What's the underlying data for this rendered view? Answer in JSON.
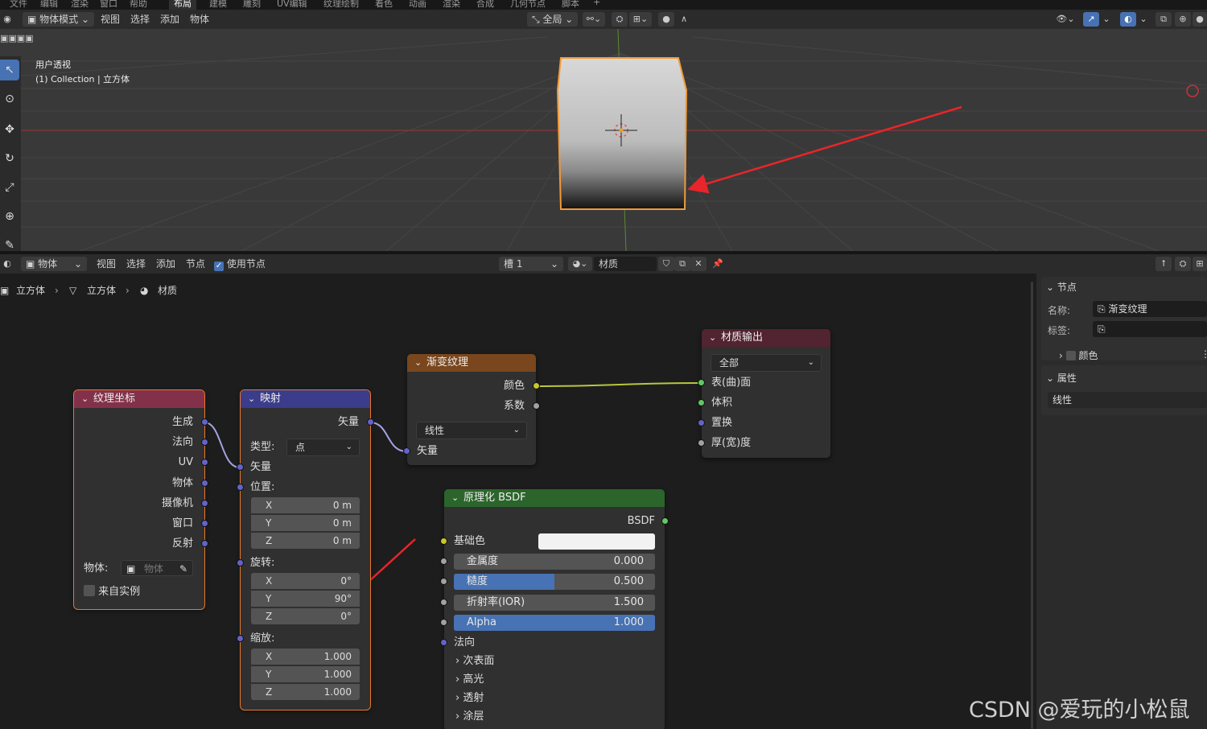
{
  "workspaces": [
    "文件",
    "编辑",
    "渲染",
    "窗口",
    "帮助",
    "布局",
    "建模",
    "雕刻",
    "UV编辑",
    "纹理绘制",
    "着色",
    "动画",
    "渲染",
    "合成",
    "几何节点",
    "脚本",
    "+"
  ],
  "viewport_header": {
    "mode": "物体模式",
    "menus": [
      "视图",
      "选择",
      "添加",
      "物体"
    ],
    "transform": "全局"
  },
  "viewport": {
    "view_name": "用户透视",
    "collection_info": "(1) Collection | 立方体"
  },
  "node_header": {
    "object_dropdown": "物体",
    "menus": [
      "视图",
      "选择",
      "添加",
      "节点"
    ],
    "use_nodes_label": "使用节点",
    "use_nodes": true,
    "slot": "槽 1",
    "material": "材质"
  },
  "breadcrumb": [
    "立方体",
    "立方体",
    "材质"
  ],
  "nodes": {
    "texcoord": {
      "title": "纹理坐标",
      "outputs": [
        "生成",
        "法向",
        "UV",
        "物体",
        "摄像机",
        "窗口",
        "反射"
      ],
      "object_label": "物体:",
      "object_placeholder": "物体",
      "from_instancer": "来自实例"
    },
    "mapping": {
      "title": "映射",
      "output": "矢量",
      "type_label": "类型:",
      "type_value": "点",
      "vector_label": "矢量",
      "location_label": "位置:",
      "location": [
        {
          "axis": "X",
          "value": "0 m"
        },
        {
          "axis": "Y",
          "value": "0 m"
        },
        {
          "axis": "Z",
          "value": "0 m"
        }
      ],
      "rotation_label": "旋转:",
      "rotation": [
        {
          "axis": "X",
          "value": "0°"
        },
        {
          "axis": "Y",
          "value": "90°"
        },
        {
          "axis": "Z",
          "value": "0°"
        }
      ],
      "scale_label": "缩放:",
      "scale": [
        {
          "axis": "X",
          "value": "1.000"
        },
        {
          "axis": "Y",
          "value": "1.000"
        },
        {
          "axis": "Z",
          "value": "1.000"
        }
      ]
    },
    "gradient": {
      "title": "渐变纹理",
      "out_color": "颜色",
      "out_fac": "系数",
      "type": "线性",
      "in_vector": "矢量"
    },
    "output": {
      "title": "材质输出",
      "target": "全部",
      "inputs": [
        "表(曲)面",
        "体积",
        "置换",
        "厚(宽)度"
      ]
    },
    "bsdf": {
      "title": "原理化 BSDF",
      "output": "BSDF",
      "base_color_label": "基础色",
      "sliders": [
        {
          "label": "金属度",
          "value": "0.000",
          "fill": 0.0
        },
        {
          "label": "糙度",
          "value": "0.500",
          "fill": 0.5
        },
        {
          "label": "折射率(IOR)",
          "value": "1.500",
          "fill": 0.0
        },
        {
          "label": "Alpha",
          "value": "1.000",
          "fill": 1.0
        }
      ],
      "normal_label": "法向",
      "panels": [
        "次表面",
        "高光",
        "透射",
        "涂层"
      ]
    }
  },
  "sidepanel": {
    "node_section": "节点",
    "name_label": "名称:",
    "name_value": "渐变纹理",
    "label_label": "标签:",
    "color_label": "颜色",
    "properties_section": "属性",
    "properties_value": "线性"
  },
  "watermark": "CSDN @爱玩的小松鼠",
  "colors": {
    "accent": "#4772b3",
    "select_outline": "#e8782f",
    "texcoord_header": "#83314a",
    "mapping_header": "#3b3c8a",
    "gradient_header": "#79461d",
    "output_header": "#522331",
    "bsdf_header": "#2b652b",
    "annotation_arrow": "#e8252a"
  }
}
